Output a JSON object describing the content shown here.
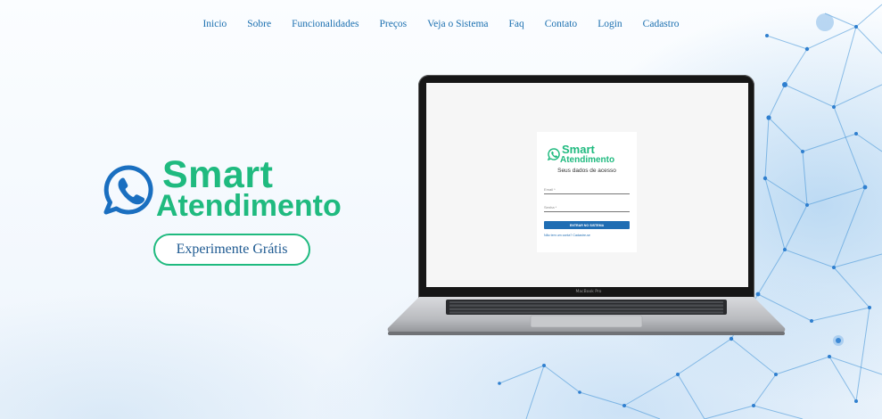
{
  "nav": {
    "items": [
      "Inicio",
      "Sobre",
      "Funcionalidades",
      "Preços",
      "Veja o Sistema",
      "Faq",
      "Contato",
      "Login",
      "Cadastro"
    ]
  },
  "hero": {
    "logo_line1": "Smart",
    "logo_line2": "Atendimento",
    "cta_label": "Experimente Grátis"
  },
  "laptop": {
    "model_label": "MacBook Pro",
    "login": {
      "logo_line1": "Smart",
      "logo_line2": "Atendimento",
      "subtitle": "Seus dados de acesso",
      "email_label": "Email *",
      "password_label": "Senha *",
      "submit_label": "ENTRAR NO SISTEMA",
      "signup_link": "Não tem um conta? Cadastre-se"
    }
  },
  "colors": {
    "brand_green": "#1fba7f",
    "nav_blue": "#1b6fb0",
    "button_blue": "#1f6db3"
  }
}
